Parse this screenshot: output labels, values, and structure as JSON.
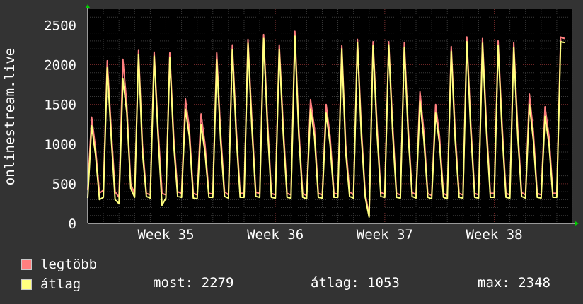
{
  "chart_data": {
    "type": "line",
    "ylabel": "onlinestream.live",
    "ylim": [
      0,
      2700
    ],
    "yticks": [
      0,
      500,
      1000,
      1500,
      2000,
      2500
    ],
    "x_tick_labels": [
      "Week 35",
      "Week 36",
      "Week 37",
      "Week 38"
    ],
    "x_tick_positions_days": [
      5,
      12,
      19,
      26
    ],
    "x_range_days": [
      0,
      31
    ],
    "grid": true,
    "series": [
      {
        "name": "legtöbb",
        "color": "#ff7f7f",
        "values": [
          {
            "day": 0.0,
            "value": 420
          },
          {
            "day": 0.25,
            "value": 1340
          },
          {
            "day": 0.5,
            "value": 950
          },
          {
            "day": 0.75,
            "value": 380
          },
          {
            "day": 1.0,
            "value": 420
          },
          {
            "day": 1.25,
            "value": 2050
          },
          {
            "day": 1.5,
            "value": 1200
          },
          {
            "day": 1.75,
            "value": 400
          },
          {
            "day": 2.0,
            "value": 330
          },
          {
            "day": 2.25,
            "value": 2070
          },
          {
            "day": 2.5,
            "value": 1500
          },
          {
            "day": 2.75,
            "value": 500
          },
          {
            "day": 3.0,
            "value": 370
          },
          {
            "day": 3.25,
            "value": 2180
          },
          {
            "day": 3.5,
            "value": 1000
          },
          {
            "day": 3.75,
            "value": 380
          },
          {
            "day": 4.0,
            "value": 360
          },
          {
            "day": 4.25,
            "value": 2160
          },
          {
            "day": 4.5,
            "value": 1200
          },
          {
            "day": 4.75,
            "value": 380
          },
          {
            "day": 5.0,
            "value": 360
          },
          {
            "day": 5.25,
            "value": 2150
          },
          {
            "day": 5.5,
            "value": 1100
          },
          {
            "day": 5.75,
            "value": 400
          },
          {
            "day": 6.0,
            "value": 380
          },
          {
            "day": 6.25,
            "value": 1570
          },
          {
            "day": 6.5,
            "value": 1200
          },
          {
            "day": 6.75,
            "value": 380
          },
          {
            "day": 7.0,
            "value": 360
          },
          {
            "day": 7.25,
            "value": 1380
          },
          {
            "day": 7.5,
            "value": 1000
          },
          {
            "day": 7.75,
            "value": 380
          },
          {
            "day": 8.0,
            "value": 370
          },
          {
            "day": 8.25,
            "value": 2150
          },
          {
            "day": 8.5,
            "value": 1150
          },
          {
            "day": 8.75,
            "value": 400
          },
          {
            "day": 9.0,
            "value": 360
          },
          {
            "day": 9.25,
            "value": 2250
          },
          {
            "day": 9.5,
            "value": 1200
          },
          {
            "day": 9.75,
            "value": 380
          },
          {
            "day": 10.0,
            "value": 380
          },
          {
            "day": 10.25,
            "value": 2320
          },
          {
            "day": 10.5,
            "value": 1300
          },
          {
            "day": 10.75,
            "value": 390
          },
          {
            "day": 11.0,
            "value": 380
          },
          {
            "day": 11.25,
            "value": 2380
          },
          {
            "day": 11.5,
            "value": 1300
          },
          {
            "day": 11.75,
            "value": 380
          },
          {
            "day": 12.0,
            "value": 360
          },
          {
            "day": 12.25,
            "value": 2250
          },
          {
            "day": 12.5,
            "value": 1250
          },
          {
            "day": 12.75,
            "value": 380
          },
          {
            "day": 13.0,
            "value": 360
          },
          {
            "day": 13.25,
            "value": 2420
          },
          {
            "day": 13.5,
            "value": 1200
          },
          {
            "day": 13.75,
            "value": 380
          },
          {
            "day": 14.0,
            "value": 350
          },
          {
            "day": 14.25,
            "value": 1560
          },
          {
            "day": 14.5,
            "value": 1200
          },
          {
            "day": 14.75,
            "value": 380
          },
          {
            "day": 15.0,
            "value": 360
          },
          {
            "day": 15.25,
            "value": 1500
          },
          {
            "day": 15.5,
            "value": 1100
          },
          {
            "day": 15.75,
            "value": 380
          },
          {
            "day": 16.0,
            "value": 370
          },
          {
            "day": 16.25,
            "value": 2240
          },
          {
            "day": 16.5,
            "value": 1000
          },
          {
            "day": 16.75,
            "value": 400
          },
          {
            "day": 17.0,
            "value": 360
          },
          {
            "day": 17.25,
            "value": 2320
          },
          {
            "day": 17.5,
            "value": 1200
          },
          {
            "day": 17.75,
            "value": 380
          },
          {
            "day": 18.0,
            "value": 100
          },
          {
            "day": 18.25,
            "value": 2290
          },
          {
            "day": 18.5,
            "value": 1250
          },
          {
            "day": 18.75,
            "value": 390
          },
          {
            "day": 19.0,
            "value": 370
          },
          {
            "day": 19.25,
            "value": 2290
          },
          {
            "day": 19.5,
            "value": 1250
          },
          {
            "day": 19.75,
            "value": 380
          },
          {
            "day": 20.0,
            "value": 360
          },
          {
            "day": 20.25,
            "value": 2280
          },
          {
            "day": 20.5,
            "value": 1200
          },
          {
            "day": 20.75,
            "value": 390
          },
          {
            "day": 21.0,
            "value": 360
          },
          {
            "day": 21.25,
            "value": 1660
          },
          {
            "day": 21.5,
            "value": 1150
          },
          {
            "day": 21.75,
            "value": 380
          },
          {
            "day": 22.0,
            "value": 350
          },
          {
            "day": 22.25,
            "value": 1500
          },
          {
            "day": 22.5,
            "value": 1100
          },
          {
            "day": 22.75,
            "value": 380
          },
          {
            "day": 23.0,
            "value": 350
          },
          {
            "day": 23.25,
            "value": 2230
          },
          {
            "day": 23.5,
            "value": 1150
          },
          {
            "day": 23.75,
            "value": 380
          },
          {
            "day": 24.0,
            "value": 360
          },
          {
            "day": 24.25,
            "value": 2350
          },
          {
            "day": 24.5,
            "value": 1250
          },
          {
            "day": 24.75,
            "value": 380
          },
          {
            "day": 25.0,
            "value": 360
          },
          {
            "day": 25.25,
            "value": 2330
          },
          {
            "day": 25.5,
            "value": 1250
          },
          {
            "day": 25.75,
            "value": 380
          },
          {
            "day": 26.0,
            "value": 380
          },
          {
            "day": 26.25,
            "value": 2300
          },
          {
            "day": 26.5,
            "value": 1250
          },
          {
            "day": 26.75,
            "value": 380
          },
          {
            "day": 27.0,
            "value": 360
          },
          {
            "day": 27.25,
            "value": 2280
          },
          {
            "day": 27.5,
            "value": 1200
          },
          {
            "day": 27.75,
            "value": 390
          },
          {
            "day": 28.0,
            "value": 360
          },
          {
            "day": 28.25,
            "value": 1630
          },
          {
            "day": 28.5,
            "value": 1150
          },
          {
            "day": 28.75,
            "value": 380
          },
          {
            "day": 29.0,
            "value": 360
          },
          {
            "day": 29.25,
            "value": 1470
          },
          {
            "day": 29.5,
            "value": 1100
          },
          {
            "day": 29.75,
            "value": 380
          },
          {
            "day": 30.0,
            "value": 380
          },
          {
            "day": 30.25,
            "value": 2348
          },
          {
            "day": 30.5,
            "value": 2330
          }
        ]
      },
      {
        "name": "átlag",
        "color": "#ffff7f",
        "values": [
          {
            "day": 0.0,
            "value": 320
          },
          {
            "day": 0.25,
            "value": 1230
          },
          {
            "day": 0.5,
            "value": 870
          },
          {
            "day": 0.75,
            "value": 300
          },
          {
            "day": 1.0,
            "value": 330
          },
          {
            "day": 1.25,
            "value": 1960
          },
          {
            "day": 1.5,
            "value": 1100
          },
          {
            "day": 1.75,
            "value": 300
          },
          {
            "day": 2.0,
            "value": 250
          },
          {
            "day": 2.25,
            "value": 1820
          },
          {
            "day": 2.5,
            "value": 1400
          },
          {
            "day": 2.75,
            "value": 440
          },
          {
            "day": 3.0,
            "value": 330
          },
          {
            "day": 3.25,
            "value": 2130
          },
          {
            "day": 3.5,
            "value": 900
          },
          {
            "day": 3.75,
            "value": 340
          },
          {
            "day": 4.0,
            "value": 320
          },
          {
            "day": 4.25,
            "value": 2110
          },
          {
            "day": 4.5,
            "value": 1100
          },
          {
            "day": 4.75,
            "value": 230
          },
          {
            "day": 5.0,
            "value": 320
          },
          {
            "day": 5.25,
            "value": 2090
          },
          {
            "day": 5.5,
            "value": 1000
          },
          {
            "day": 5.75,
            "value": 340
          },
          {
            "day": 6.0,
            "value": 330
          },
          {
            "day": 6.25,
            "value": 1440
          },
          {
            "day": 6.5,
            "value": 1100
          },
          {
            "day": 6.75,
            "value": 320
          },
          {
            "day": 7.0,
            "value": 310
          },
          {
            "day": 7.25,
            "value": 1240
          },
          {
            "day": 7.5,
            "value": 900
          },
          {
            "day": 7.75,
            "value": 330
          },
          {
            "day": 8.0,
            "value": 330
          },
          {
            "day": 8.25,
            "value": 2060
          },
          {
            "day": 8.5,
            "value": 1050
          },
          {
            "day": 8.75,
            "value": 340
          },
          {
            "day": 9.0,
            "value": 320
          },
          {
            "day": 9.25,
            "value": 2190
          },
          {
            "day": 9.5,
            "value": 1100
          },
          {
            "day": 9.75,
            "value": 330
          },
          {
            "day": 10.0,
            "value": 330
          },
          {
            "day": 10.25,
            "value": 2270
          },
          {
            "day": 10.5,
            "value": 1200
          },
          {
            "day": 10.75,
            "value": 340
          },
          {
            "day": 11.0,
            "value": 330
          },
          {
            "day": 11.25,
            "value": 2330
          },
          {
            "day": 11.5,
            "value": 1200
          },
          {
            "day": 11.75,
            "value": 330
          },
          {
            "day": 12.0,
            "value": 320
          },
          {
            "day": 12.25,
            "value": 2190
          },
          {
            "day": 12.5,
            "value": 1150
          },
          {
            "day": 12.75,
            "value": 330
          },
          {
            "day": 13.0,
            "value": 320
          },
          {
            "day": 13.25,
            "value": 2360
          },
          {
            "day": 13.5,
            "value": 1100
          },
          {
            "day": 13.75,
            "value": 330
          },
          {
            "day": 14.0,
            "value": 310
          },
          {
            "day": 14.25,
            "value": 1440
          },
          {
            "day": 14.5,
            "value": 1100
          },
          {
            "day": 14.75,
            "value": 330
          },
          {
            "day": 15.0,
            "value": 320
          },
          {
            "day": 15.25,
            "value": 1390
          },
          {
            "day": 15.5,
            "value": 1000
          },
          {
            "day": 15.75,
            "value": 330
          },
          {
            "day": 16.0,
            "value": 330
          },
          {
            "day": 16.25,
            "value": 2200
          },
          {
            "day": 16.5,
            "value": 900
          },
          {
            "day": 16.75,
            "value": 340
          },
          {
            "day": 17.0,
            "value": 320
          },
          {
            "day": 17.25,
            "value": 2280
          },
          {
            "day": 17.5,
            "value": 1100
          },
          {
            "day": 17.75,
            "value": 330
          },
          {
            "day": 18.0,
            "value": 80
          },
          {
            "day": 18.25,
            "value": 2240
          },
          {
            "day": 18.5,
            "value": 1150
          },
          {
            "day": 18.75,
            "value": 340
          },
          {
            "day": 19.0,
            "value": 330
          },
          {
            "day": 19.25,
            "value": 2250
          },
          {
            "day": 19.5,
            "value": 1150
          },
          {
            "day": 19.75,
            "value": 330
          },
          {
            "day": 20.0,
            "value": 320
          },
          {
            "day": 20.25,
            "value": 2220
          },
          {
            "day": 20.5,
            "value": 1100
          },
          {
            "day": 20.75,
            "value": 340
          },
          {
            "day": 21.0,
            "value": 320
          },
          {
            "day": 21.25,
            "value": 1540
          },
          {
            "day": 21.5,
            "value": 1050
          },
          {
            "day": 21.75,
            "value": 330
          },
          {
            "day": 22.0,
            "value": 310
          },
          {
            "day": 22.25,
            "value": 1390
          },
          {
            "day": 22.5,
            "value": 1000
          },
          {
            "day": 22.75,
            "value": 330
          },
          {
            "day": 23.0,
            "value": 310
          },
          {
            "day": 23.25,
            "value": 2170
          },
          {
            "day": 23.5,
            "value": 1050
          },
          {
            "day": 23.75,
            "value": 330
          },
          {
            "day": 24.0,
            "value": 320
          },
          {
            "day": 24.25,
            "value": 2290
          },
          {
            "day": 24.5,
            "value": 1150
          },
          {
            "day": 24.75,
            "value": 330
          },
          {
            "day": 25.0,
            "value": 320
          },
          {
            "day": 25.25,
            "value": 2270
          },
          {
            "day": 25.5,
            "value": 1150
          },
          {
            "day": 25.75,
            "value": 330
          },
          {
            "day": 26.0,
            "value": 330
          },
          {
            "day": 26.25,
            "value": 2240
          },
          {
            "day": 26.5,
            "value": 1150
          },
          {
            "day": 26.75,
            "value": 330
          },
          {
            "day": 27.0,
            "value": 320
          },
          {
            "day": 27.25,
            "value": 2220
          },
          {
            "day": 27.5,
            "value": 1100
          },
          {
            "day": 27.75,
            "value": 340
          },
          {
            "day": 28.0,
            "value": 320
          },
          {
            "day": 28.25,
            "value": 1500
          },
          {
            "day": 28.5,
            "value": 1050
          },
          {
            "day": 28.75,
            "value": 330
          },
          {
            "day": 29.0,
            "value": 320
          },
          {
            "day": 29.25,
            "value": 1350
          },
          {
            "day": 29.5,
            "value": 1000
          },
          {
            "day": 29.75,
            "value": 330
          },
          {
            "day": 30.0,
            "value": 330
          },
          {
            "day": 30.25,
            "value": 2290
          },
          {
            "day": 30.5,
            "value": 2279
          }
        ]
      }
    ]
  },
  "legend": {
    "max_label": "legtöbb",
    "avg_label": "átlag",
    "max_color": "#ff7f7f",
    "avg_color": "#ffff7f"
  },
  "stats": {
    "now": "most: 2279",
    "avg": "átlag: 1053",
    "max": "max: 2348"
  }
}
